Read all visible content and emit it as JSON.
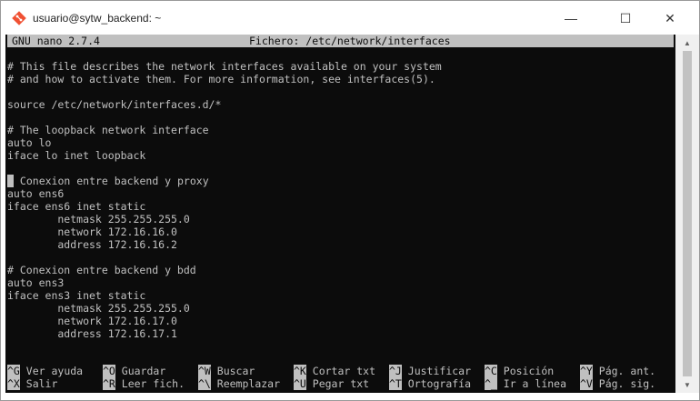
{
  "window": {
    "title": "usuario@sytw_backend: ~",
    "minimize_glyph": "—",
    "maximize_glyph": "☐",
    "close_glyph": "✕",
    "icon": "git-diamond-icon"
  },
  "nano": {
    "version": "GNU nano 2.7.4",
    "file_label": "Fichero: /etc/network/interfaces"
  },
  "file_lines": [
    "",
    "# This file describes the network interfaces available on your system",
    "# and how to activate them. For more information, see interfaces(5).",
    "",
    "source /etc/network/interfaces.d/*",
    "",
    "# The loopback network interface",
    "auto lo",
    "iface lo inet loopback",
    "",
    " Conexion entre backend y proxy",
    "auto ens6",
    "iface ens6 inet static",
    "        netmask 255.255.255.0",
    "        network 172.16.16.0",
    "        address 172.16.16.2",
    "",
    "# Conexion entre backend y bdd",
    "auto ens3",
    "iface ens3 inet static",
    "        netmask 255.255.255.0",
    "        network 172.16.17.0",
    "        address 172.16.17.1"
  ],
  "shortcuts": [
    [
      {
        "key": "^G",
        "label": "Ver ayuda"
      },
      {
        "key": "^O",
        "label": "Guardar"
      },
      {
        "key": "^W",
        "label": "Buscar"
      },
      {
        "key": "^K",
        "label": "Cortar txt"
      },
      {
        "key": "^J",
        "label": "Justificar"
      },
      {
        "key": "^C",
        "label": "Posición"
      },
      {
        "key": "^Y",
        "label": "Pág. ant."
      }
    ],
    [
      {
        "key": "^X",
        "label": "Salir"
      },
      {
        "key": "^R",
        "label": "Leer fich."
      },
      {
        "key": "^\\",
        "label": "Reemplazar"
      },
      {
        "key": "^U",
        "label": "Pegar txt"
      },
      {
        "key": "^T",
        "label": "Ortografía"
      },
      {
        "key": "^_",
        "label": "Ir a línea"
      },
      {
        "key": "^V",
        "label": "Pág. sig."
      }
    ]
  ],
  "colors": {
    "terminal_bg": "#0c0c0c",
    "terminal_fg": "#c0c0c0"
  }
}
